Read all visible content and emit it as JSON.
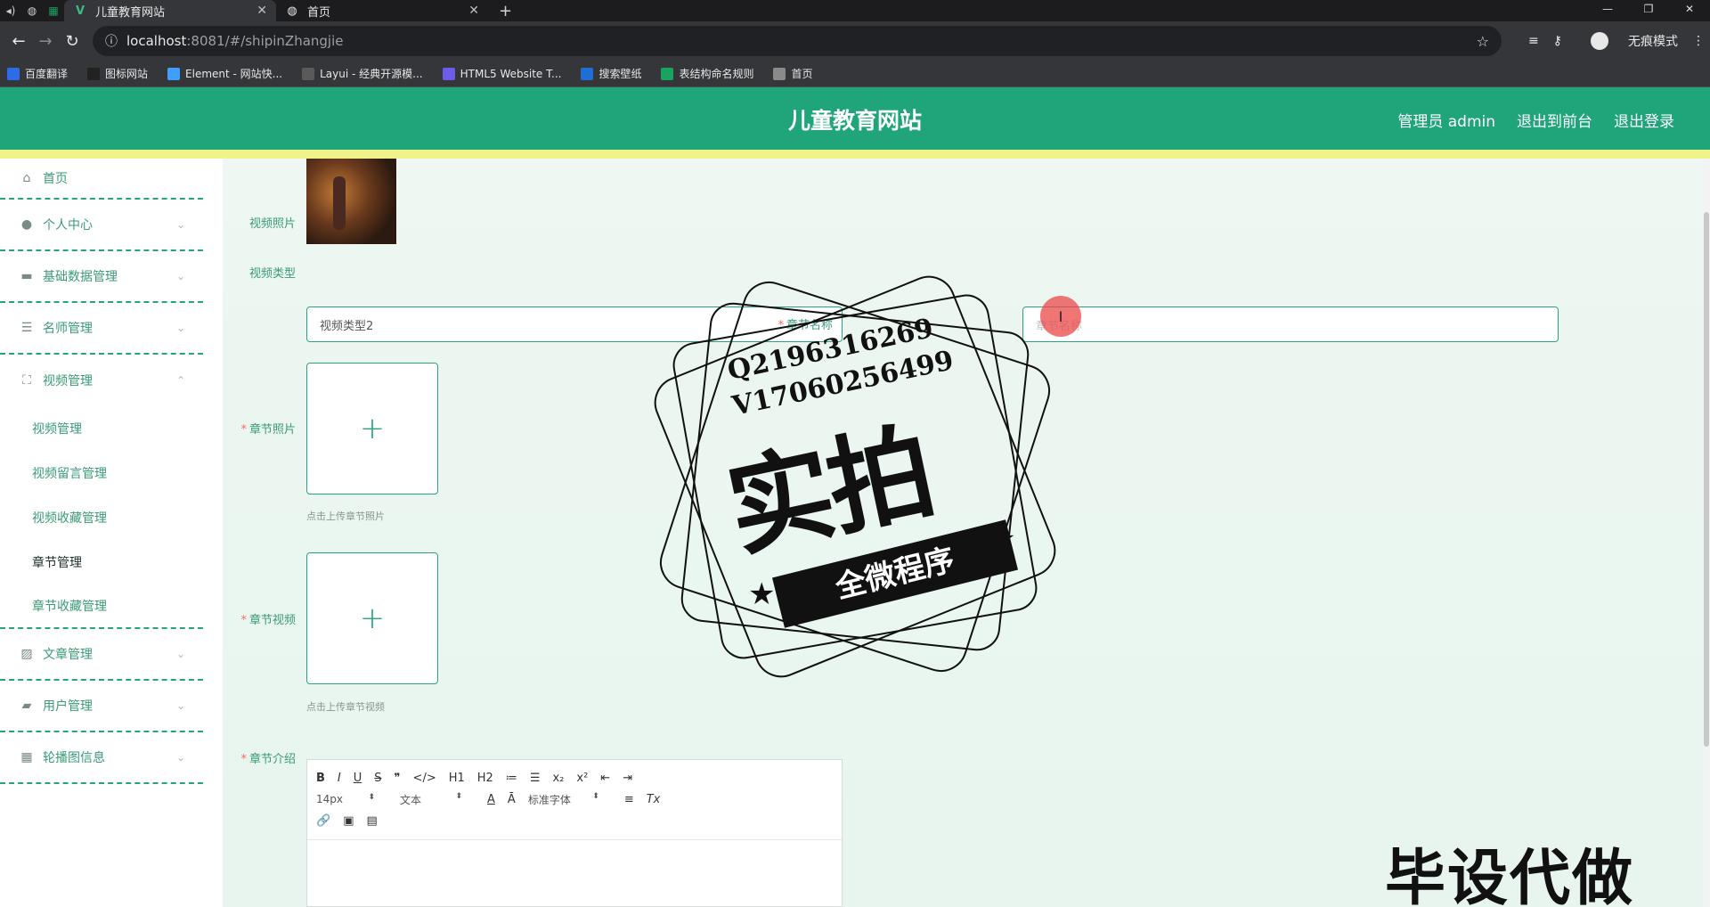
{
  "browser": {
    "tabs": [
      {
        "title": "儿童教育网站",
        "active": true,
        "icon": "vue-icon"
      },
      {
        "title": "首页",
        "active": false,
        "icon": "globe-icon"
      }
    ],
    "address": {
      "host": "localhost",
      "rest": ":8081/#/shipinZhangjie"
    },
    "incognito_label": "无痕模式",
    "bookmarks": [
      {
        "label": "百度翻译",
        "icon": "translate-icon",
        "color": "#2e6be6"
      },
      {
        "label": "图标网站",
        "icon": "flag-icon",
        "color": "#222222"
      },
      {
        "label": "Element - 网站快...",
        "icon": "element-icon",
        "color": "#409eff"
      },
      {
        "label": "Layui - 经典开源模...",
        "icon": "layui-icon",
        "color": "#5a5a5a"
      },
      {
        "label": "HTML5 Website T...",
        "icon": "html5-icon",
        "color": "#6c5ce7"
      },
      {
        "label": "搜索壁纸",
        "icon": "wallpaper-icon",
        "color": "#1d6fd6"
      },
      {
        "label": "表结构命名规则",
        "icon": "sheet-icon",
        "color": "#1aa260"
      },
      {
        "label": "首页",
        "icon": "globe-icon",
        "color": "#8a8a8a"
      }
    ]
  },
  "header": {
    "title": "儿童教育网站",
    "links": [
      "管理员 admin",
      "退出到前台",
      "退出登录"
    ]
  },
  "sidebar": {
    "items": [
      {
        "label": "首页",
        "icon": "home-icon"
      },
      {
        "label": "个人中心",
        "icon": "user-icon"
      },
      {
        "label": "基础数据管理",
        "icon": "comment-icon"
      },
      {
        "label": "名师管理",
        "icon": "list-icon"
      },
      {
        "label": "视频管理",
        "icon": "fullscreen-icon"
      },
      {
        "label": "文章管理",
        "icon": "picture-icon"
      },
      {
        "label": "用户管理",
        "icon": "camera-icon"
      },
      {
        "label": "轮播图信息",
        "icon": "grid-icon"
      }
    ],
    "sub_items": [
      "视频管理",
      "视频留言管理",
      "视频收藏管理",
      "章节管理",
      "章节收藏管理"
    ]
  },
  "form": {
    "video_photo_label": "视频照片",
    "video_type_label": "视频类型",
    "video_type_value": "视频类型2",
    "chapter_name_label": "章节名称",
    "chapter_name_placeholder": "章节名称",
    "chapter_photo_label": "章节照片",
    "chapter_photo_hint": "点击上传章节照片",
    "chapter_video_label": "章节视频",
    "chapter_video_hint": "点击上传章节视频",
    "chapter_intro_label": "章节介绍",
    "upload_plus": "+"
  },
  "editor": {
    "row1": [
      "B",
      "I",
      "U",
      "S",
      "❞",
      "</>",
      "H1",
      "H2",
      "≔",
      "☰",
      "x₂",
      "x²",
      "⇤",
      "⇥"
    ],
    "font_size": "14px",
    "text_style": "文本",
    "font_family": "标准字体",
    "row2_icons": [
      "A",
      "Ā",
      "≡",
      "Tx"
    ],
    "row3_icons": [
      "🔗",
      "▣",
      "▤"
    ]
  },
  "overlay": {
    "qq": "Q2196316269",
    "wechat": "V17060256499",
    "stamp_main": "实拍",
    "stamp_ribbon": "全微程序",
    "bottom_watermark": "毕设代做"
  },
  "colors": {
    "accent": "#20a57a",
    "header_strip": "#f0f28a"
  }
}
